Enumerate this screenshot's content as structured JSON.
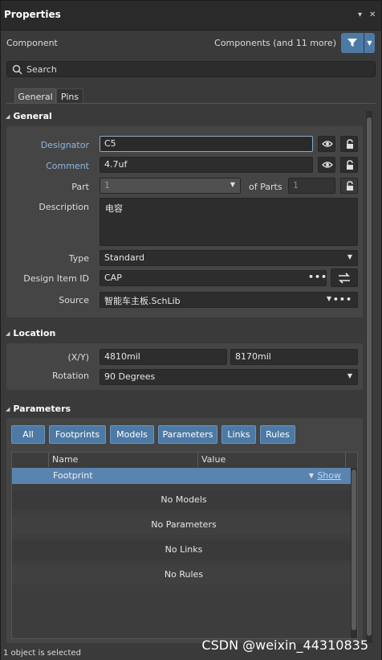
{
  "titlebar": {
    "title": "Properties",
    "pin_glyph": "▾",
    "close_glyph": "✕"
  },
  "component": {
    "label": "Component",
    "count_label": "Components (and 11 more)"
  },
  "search": {
    "placeholder": "Search"
  },
  "tabs": [
    {
      "label": "General"
    },
    {
      "label": "Pins"
    }
  ],
  "general": {
    "header": "General",
    "designator": {
      "label": "Designator",
      "value": "C5"
    },
    "comment": {
      "label": "Comment",
      "value": "4.7uf"
    },
    "part": {
      "label": "Part",
      "value": "1",
      "of_parts_label": "of Parts",
      "of_parts_value": "1"
    },
    "description": {
      "label": "Description",
      "value": "电容"
    },
    "type": {
      "label": "Type",
      "value": "Standard"
    },
    "design_item_id": {
      "label": "Design Item ID",
      "value": "CAP"
    },
    "source": {
      "label": "Source",
      "value": "智能车主板.SchLib"
    }
  },
  "location": {
    "header": "Location",
    "xy": {
      "label": "(X/Y)",
      "x": "4810mil",
      "y": "8170mil"
    },
    "rotation": {
      "label": "Rotation",
      "value": "90 Degrees"
    }
  },
  "parameters": {
    "header": "Parameters",
    "filter_buttons": [
      "All",
      "Footprints",
      "Models",
      "Parameters",
      "Links",
      "Rules"
    ],
    "columns": [
      "Name",
      "Value"
    ],
    "selected_row": {
      "name": "Footprint",
      "value": "",
      "action": "Show"
    },
    "empty_rows": [
      "No Models",
      "No Parameters",
      "No Links",
      "No Rules"
    ]
  },
  "status": {
    "text": "1 object is selected"
  },
  "watermark": "CSDN @weixin_44310835",
  "colors": {
    "accent": "#4d7aa5",
    "panel": "#3a3a3a",
    "link": "#8fb6e0"
  }
}
